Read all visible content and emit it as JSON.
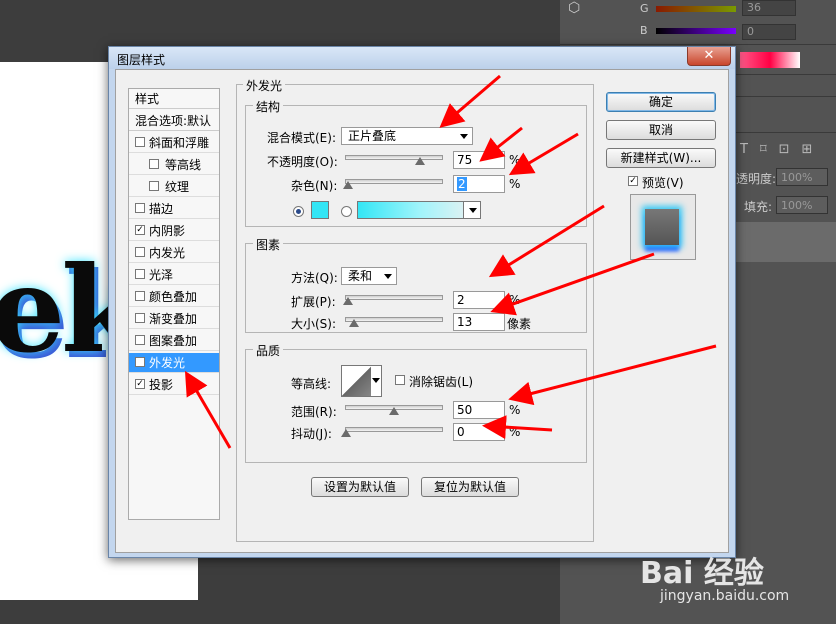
{
  "background": {
    "doc_text": "ek",
    "color_panel": {
      "g_label": "G",
      "b_label": "B",
      "g_value": "36",
      "b_value": "0"
    },
    "layers_panel": {
      "opacity_label": "透明度:",
      "opacity_value": "100%",
      "fill_label": "填充:",
      "fill_value": "100%"
    }
  },
  "dialog": {
    "title": "图层样式",
    "close_label": "✕",
    "style_list": {
      "header": "样式",
      "blend_options": "混合选项:默认",
      "items": [
        {
          "label": "斜面和浮雕",
          "checked": false,
          "indent": false
        },
        {
          "label": "等高线",
          "checked": false,
          "indent": true
        },
        {
          "label": "纹理",
          "checked": false,
          "indent": true
        },
        {
          "label": "描边",
          "checked": false,
          "indent": false
        },
        {
          "label": "内阴影",
          "checked": true,
          "indent": false
        },
        {
          "label": "内发光",
          "checked": false,
          "indent": false
        },
        {
          "label": "光泽",
          "checked": false,
          "indent": false
        },
        {
          "label": "颜色叠加",
          "checked": false,
          "indent": false
        },
        {
          "label": "渐变叠加",
          "checked": false,
          "indent": false
        },
        {
          "label": "图案叠加",
          "checked": false,
          "indent": false
        },
        {
          "label": "外发光",
          "checked": true,
          "indent": false,
          "selected": true
        },
        {
          "label": "投影",
          "checked": true,
          "indent": false
        }
      ]
    },
    "panel_title": "外发光",
    "structure": {
      "title": "结构",
      "blend_mode_label": "混合模式(E):",
      "blend_mode_value": "正片叠底",
      "opacity_label": "不透明度(O):",
      "opacity_value": "75",
      "noise_label": "杂色(N):",
      "noise_value": "2",
      "percent": "%",
      "glow_color": "#33e6f5"
    },
    "elements": {
      "title": "图素",
      "technique_label": "方法(Q):",
      "technique_value": "柔和",
      "spread_label": "扩展(P):",
      "spread_value": "2",
      "size_label": "大小(S):",
      "size_value": "13",
      "size_unit": "像素",
      "percent": "%"
    },
    "quality": {
      "title": "品质",
      "contour_label": "等高线:",
      "antialias_label": "消除锯齿(L)",
      "range_label": "范围(R):",
      "range_value": "50",
      "jitter_label": "抖动(J):",
      "jitter_value": "0",
      "percent": "%"
    },
    "make_default": "设置为默认值",
    "reset_default": "复位为默认值",
    "buttons": {
      "ok": "确定",
      "cancel": "取消",
      "new_style": "新建样式(W)...",
      "preview_label": "预览(V)"
    }
  },
  "watermark": {
    "logo": "Bai 经验",
    "url": "jingyan.baidu.com"
  },
  "colors": {
    "arrow": "#ff0000",
    "selection": "#3399ff"
  }
}
